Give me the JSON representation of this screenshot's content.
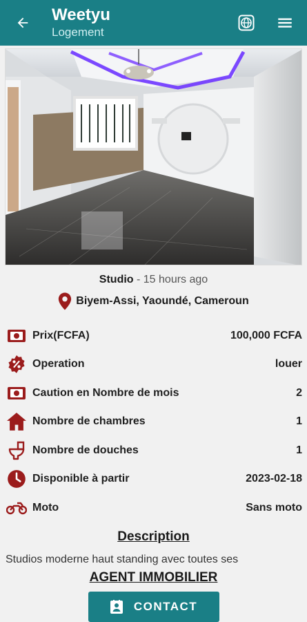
{
  "appbar": {
    "title": "Weetyu",
    "subtitle": "Logement",
    "icons": [
      "back-arrow-icon",
      "globe-icon",
      "hamburger-menu-icon"
    ]
  },
  "listing": {
    "type": "Studio",
    "time_ago": " - 15 hours ago",
    "location": "Biyem-Assi, Yaoundé, Cameroun"
  },
  "details": [
    {
      "label": "Prix(FCFA)",
      "value": "100,000 FCFA",
      "icon": "money-icon"
    },
    {
      "label": "Operation",
      "value": "louer",
      "icon": "discount-icon"
    },
    {
      "label": "Caution en Nombre de mois",
      "value": "2",
      "icon": "money-icon"
    },
    {
      "label": "Nombre de chambres",
      "value": "1",
      "icon": "house-icon"
    },
    {
      "label": "Nombre de douches",
      "value": "1",
      "icon": "toilet-icon"
    },
    {
      "label": "Disponible à partir",
      "value": "2023-02-18",
      "icon": "clock-icon"
    },
    {
      "label": "Moto",
      "value": "Sans moto",
      "icon": "motorcycle-icon"
    }
  ],
  "description": {
    "title": "Description",
    "text": "Studios moderne haut standing avec toutes ses"
  },
  "agent_label": "AGENT IMMOBILIER",
  "contact_label": "CONTACT",
  "colors": {
    "primary": "#1a7f86",
    "icon_red": "#9b1c1c",
    "background": "#f1f1f1"
  }
}
